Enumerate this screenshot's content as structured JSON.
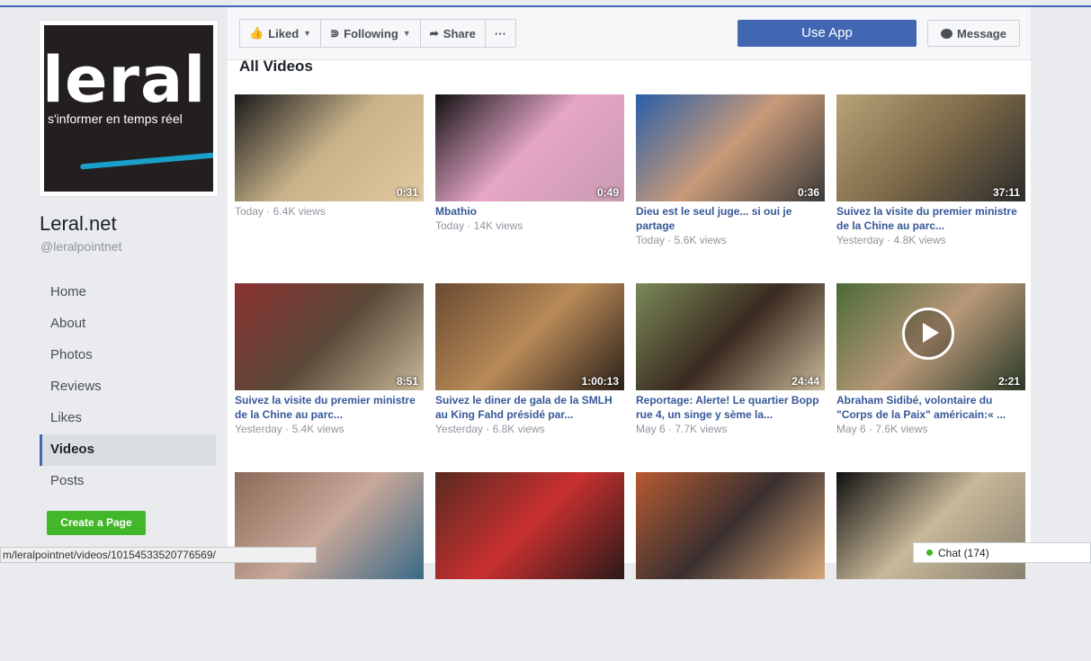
{
  "page": {
    "logo_word": "leral",
    "logo_tagline": "s'informer en temps réel",
    "name": "Leral.net",
    "handle": "@leralpointnet"
  },
  "nav": [
    {
      "label": "Home",
      "active": false
    },
    {
      "label": "About",
      "active": false
    },
    {
      "label": "Photos",
      "active": false
    },
    {
      "label": "Reviews",
      "active": false
    },
    {
      "label": "Likes",
      "active": false
    },
    {
      "label": "Videos",
      "active": true
    },
    {
      "label": "Posts",
      "active": false
    }
  ],
  "create_page_label": "Create a Page",
  "actions": {
    "liked": "Liked",
    "following": "Following",
    "share": "Share",
    "more": "···",
    "use_app": "Use App",
    "message": "Message"
  },
  "section_title": "All Videos",
  "videos": [
    {
      "title": "",
      "meta": "Today · 6.4K views",
      "duration": "0:31",
      "colors": [
        "#1a1a1a",
        "#c9b38a",
        "#e0c8a0"
      ]
    },
    {
      "title": "Mbathio",
      "meta": "Today · 14K views",
      "duration": "0:49",
      "colors": [
        "#111111",
        "#e6a6c8",
        "#c79ab0"
      ]
    },
    {
      "title": "Dieu est le seul juge... si oui je partage",
      "meta": "Today · 5.6K views",
      "duration": "0:36",
      "colors": [
        "#2a5ea8",
        "#c89a78",
        "#3a3a3a"
      ]
    },
    {
      "title": "Suivez la visite du premier ministre de la Chine au parc...",
      "meta": "Yesterday · 4.8K views",
      "duration": "37:11",
      "colors": [
        "#b8a478",
        "#7d6a48",
        "#2c2c2c"
      ]
    },
    {
      "title": "Suivez la visite du premier ministre de la Chine au parc...",
      "meta": "Yesterday · 5.4K views",
      "duration": "8:51",
      "colors": [
        "#8a3030",
        "#5a4838",
        "#c9b89a"
      ]
    },
    {
      "title": "Suivez le diner de gala de la SMLH au King Fahd présidé par...",
      "meta": "Yesterday · 6.8K views",
      "duration": "1:00:13",
      "colors": [
        "#6a4a30",
        "#b88a58",
        "#2a2018"
      ]
    },
    {
      "title": "Reportage: Alerte! Le quartier Bopp rue 4, un singe y sème la...",
      "meta": "May 6 · 7.7K views",
      "duration": "24:44",
      "colors": [
        "#7a8a58",
        "#3a2a20",
        "#c8b898"
      ]
    },
    {
      "title": "Abraham Sidibé, volontaire du \"Corps de la Paix\" américain:« ...",
      "meta": "May 6 · 7.6K views",
      "duration": "2:21",
      "colors": [
        "#4a6a38",
        "#b89878",
        "#2a3a28"
      ],
      "play_overlay": true
    },
    {
      "title": "",
      "meta": "",
      "duration": "",
      "colors": [
        "#8a6a58",
        "#c8a898",
        "#3a6a88"
      ]
    },
    {
      "title": "",
      "meta": "",
      "duration": "",
      "colors": [
        "#5a2a20",
        "#c83030",
        "#2a1a18"
      ]
    },
    {
      "title": "",
      "meta": "",
      "duration": "",
      "colors": [
        "#b85a30",
        "#3a3030",
        "#d8a878"
      ]
    },
    {
      "title": "",
      "meta": "",
      "duration": "",
      "colors": [
        "#111111",
        "#c8b898",
        "#888070"
      ]
    }
  ],
  "status_url": "m/leralpointnet/videos/10154533520776569/",
  "chat_label": "Chat (174)"
}
